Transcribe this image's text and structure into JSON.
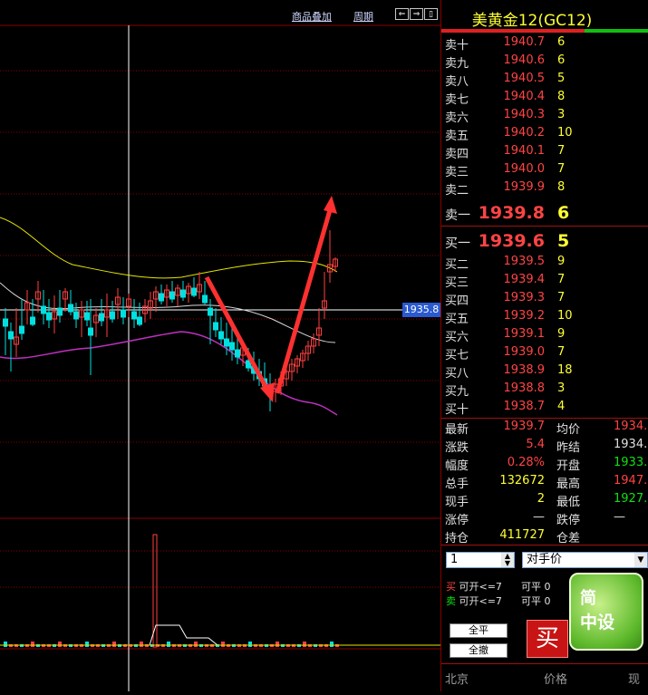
{
  "toolbar": {
    "overlay_label": "商品叠加",
    "period_label": "周期"
  },
  "chart": {
    "price_tag": "1935.8",
    "colors": {
      "up": "#ff4040",
      "down": "#00e0e0",
      "grid": "#8a0000",
      "upper_band": "#e6e600",
      "lower_band": "#c030c0",
      "mid_band": "#d8d8d8",
      "arrow": "#ff3030",
      "volume": "#ff4040"
    }
  },
  "quote": {
    "title": "美黄金12(GC12)",
    "asks": [
      {
        "label": "卖十",
        "price": "1940.7",
        "vol": "6"
      },
      {
        "label": "卖九",
        "price": "1940.6",
        "vol": "6"
      },
      {
        "label": "卖八",
        "price": "1940.5",
        "vol": "5"
      },
      {
        "label": "卖七",
        "price": "1940.4",
        "vol": "8"
      },
      {
        "label": "卖六",
        "price": "1940.3",
        "vol": "3"
      },
      {
        "label": "卖五",
        "price": "1940.2",
        "vol": "10"
      },
      {
        "label": "卖四",
        "price": "1940.1",
        "vol": "7"
      },
      {
        "label": "卖三",
        "price": "1940.0",
        "vol": "7"
      },
      {
        "label": "卖二",
        "price": "1939.9",
        "vol": "8"
      }
    ],
    "ask1": {
      "label": "卖一",
      "price": "1939.8",
      "vol": "6"
    },
    "bid1": {
      "label": "买一",
      "price": "1939.6",
      "vol": "5"
    },
    "bids": [
      {
        "label": "买二",
        "price": "1939.5",
        "vol": "9"
      },
      {
        "label": "买三",
        "price": "1939.4",
        "vol": "7"
      },
      {
        "label": "买四",
        "price": "1939.3",
        "vol": "7"
      },
      {
        "label": "买五",
        "price": "1939.2",
        "vol": "10"
      },
      {
        "label": "买六",
        "price": "1939.1",
        "vol": "9"
      },
      {
        "label": "买七",
        "price": "1939.0",
        "vol": "7"
      },
      {
        "label": "买八",
        "price": "1938.9",
        "vol": "18"
      },
      {
        "label": "买九",
        "price": "1938.8",
        "vol": "3"
      },
      {
        "label": "买十",
        "price": "1938.7",
        "vol": "4"
      }
    ],
    "stats": {
      "last_label": "最新",
      "last": "1939.7",
      "avg_label": "均价",
      "avg": "1934.",
      "chg_label": "涨跌",
      "chg": "5.4",
      "prev_label": "昨结",
      "prev": "1934.",
      "amp_label": "幅度",
      "amp": "0.28%",
      "open_label": "开盘",
      "open": "1933.",
      "total_label": "总手",
      "total": "132672",
      "high_label": "最高",
      "high": "1947.",
      "cur_label": "现手",
      "cur": "2",
      "low_label": "最低",
      "low": "1927.",
      "limup_label": "涨停",
      "limup": "—",
      "limdn_label": "跌停",
      "limdn": "—",
      "oi_label": "持仓",
      "oi": "411727",
      "oidiff_label": "仓差",
      "oidiff": ""
    }
  },
  "order": {
    "qty": "1",
    "price_type": "对手价",
    "buy_label": "买",
    "buy_open": "可开<=7",
    "buy_close": "可平 0",
    "sell_label": "卖",
    "sell_open": "可开<=7",
    "sell_close": "可平 0",
    "close_all": "全平",
    "cancel_all": "全撤",
    "buy_button": "买",
    "logo_line1": "简",
    "logo_line2": "中设"
  },
  "footer": {
    "city": "北京",
    "price": "价格",
    "now": "现"
  }
}
